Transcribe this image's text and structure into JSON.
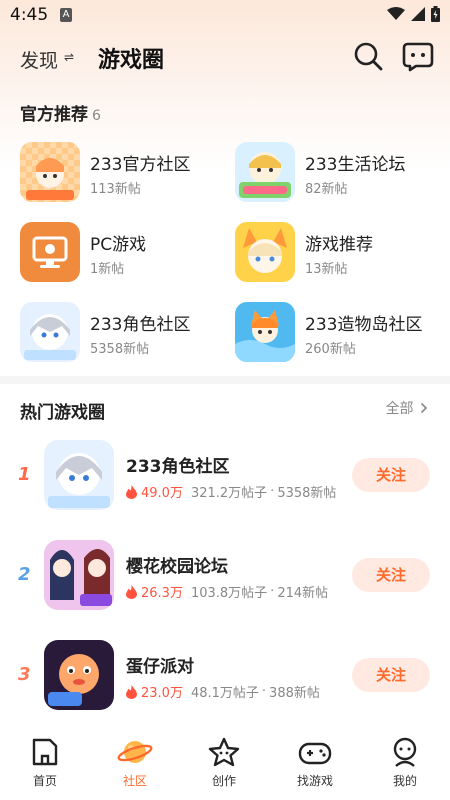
{
  "status_bar": {
    "time": "4:45",
    "notif_badge": "A"
  },
  "header": {
    "discover_label": "发现",
    "swap_glyph": "⇌",
    "title": "游戏圈",
    "search_icon": "search-icon",
    "chat_icon": "chat-icon"
  },
  "official": {
    "title": "官方推荐",
    "count": "6",
    "items": [
      {
        "name": "233官方社区",
        "posts": "113新帖",
        "icon": "official-community-thumb"
      },
      {
        "name": "233生活论坛",
        "posts": "82新帖",
        "icon": "life-forum-thumb"
      },
      {
        "name": "PC游戏",
        "posts": "1新帖",
        "icon": "pc-game-thumb"
      },
      {
        "name": "游戏推荐",
        "posts": "13新帖",
        "icon": "game-recommend-thumb"
      },
      {
        "name": "233角色社区",
        "posts": "5358新帖",
        "icon": "role-community-thumb"
      },
      {
        "name": "233造物岛社区",
        "posts": "260新帖",
        "icon": "creation-island-thumb"
      }
    ]
  },
  "hot": {
    "title": "热门游戏圈",
    "all_label": "全部",
    "follow_label": "关注",
    "items": [
      {
        "rank": "1",
        "name": "233角色社区",
        "heat": "49.0万",
        "posts": "321.2万帖子",
        "new_posts": "5358新帖"
      },
      {
        "rank": "2",
        "name": "樱花校园论坛",
        "heat": "26.3万",
        "posts": "103.8万帖子",
        "new_posts": "214新帖"
      },
      {
        "rank": "3",
        "name": "蛋仔派对",
        "heat": "23.0万",
        "posts": "48.1万帖子",
        "new_posts": "388新帖"
      }
    ],
    "separator": "·"
  },
  "bottom_nav": {
    "items": [
      {
        "label": "首页",
        "icon": "home-icon"
      },
      {
        "label": "社区",
        "icon": "planet-icon"
      },
      {
        "label": "创作",
        "icon": "star-icon"
      },
      {
        "label": "找游戏",
        "icon": "gamepad-icon"
      },
      {
        "label": "我的",
        "icon": "profile-icon"
      }
    ],
    "active_label": "社区"
  },
  "colors": {
    "accent": "#ff6a2c",
    "heat": "#ff5340",
    "rank1": "#ff6a4a",
    "rank2": "#5aa0e6",
    "rank3": "#ff7a5a"
  }
}
